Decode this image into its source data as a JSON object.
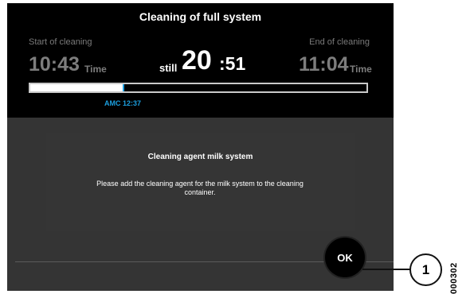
{
  "header": {
    "title": "Cleaning of full system"
  },
  "times": {
    "start_label": "Start of cleaning",
    "start_time": "10:43",
    "end_label": "End of cleaning",
    "end_time": "11:04",
    "unit": "Time",
    "still_word": "still",
    "still_minutes": "20",
    "still_seconds": ":51"
  },
  "progress": {
    "fraction": 0.28,
    "marker_label": "AMC 12:37"
  },
  "message": {
    "title": "Cleaning agent milk system",
    "body": "Please add the cleaning agent for the milk system to the cleaning container."
  },
  "ok_button": {
    "label": "OK"
  },
  "callout": {
    "number": "1"
  },
  "figure_code": "000302",
  "colors": {
    "accent": "#1c9fdf",
    "screen_bg": "#343434",
    "header_bg": "#000000"
  }
}
